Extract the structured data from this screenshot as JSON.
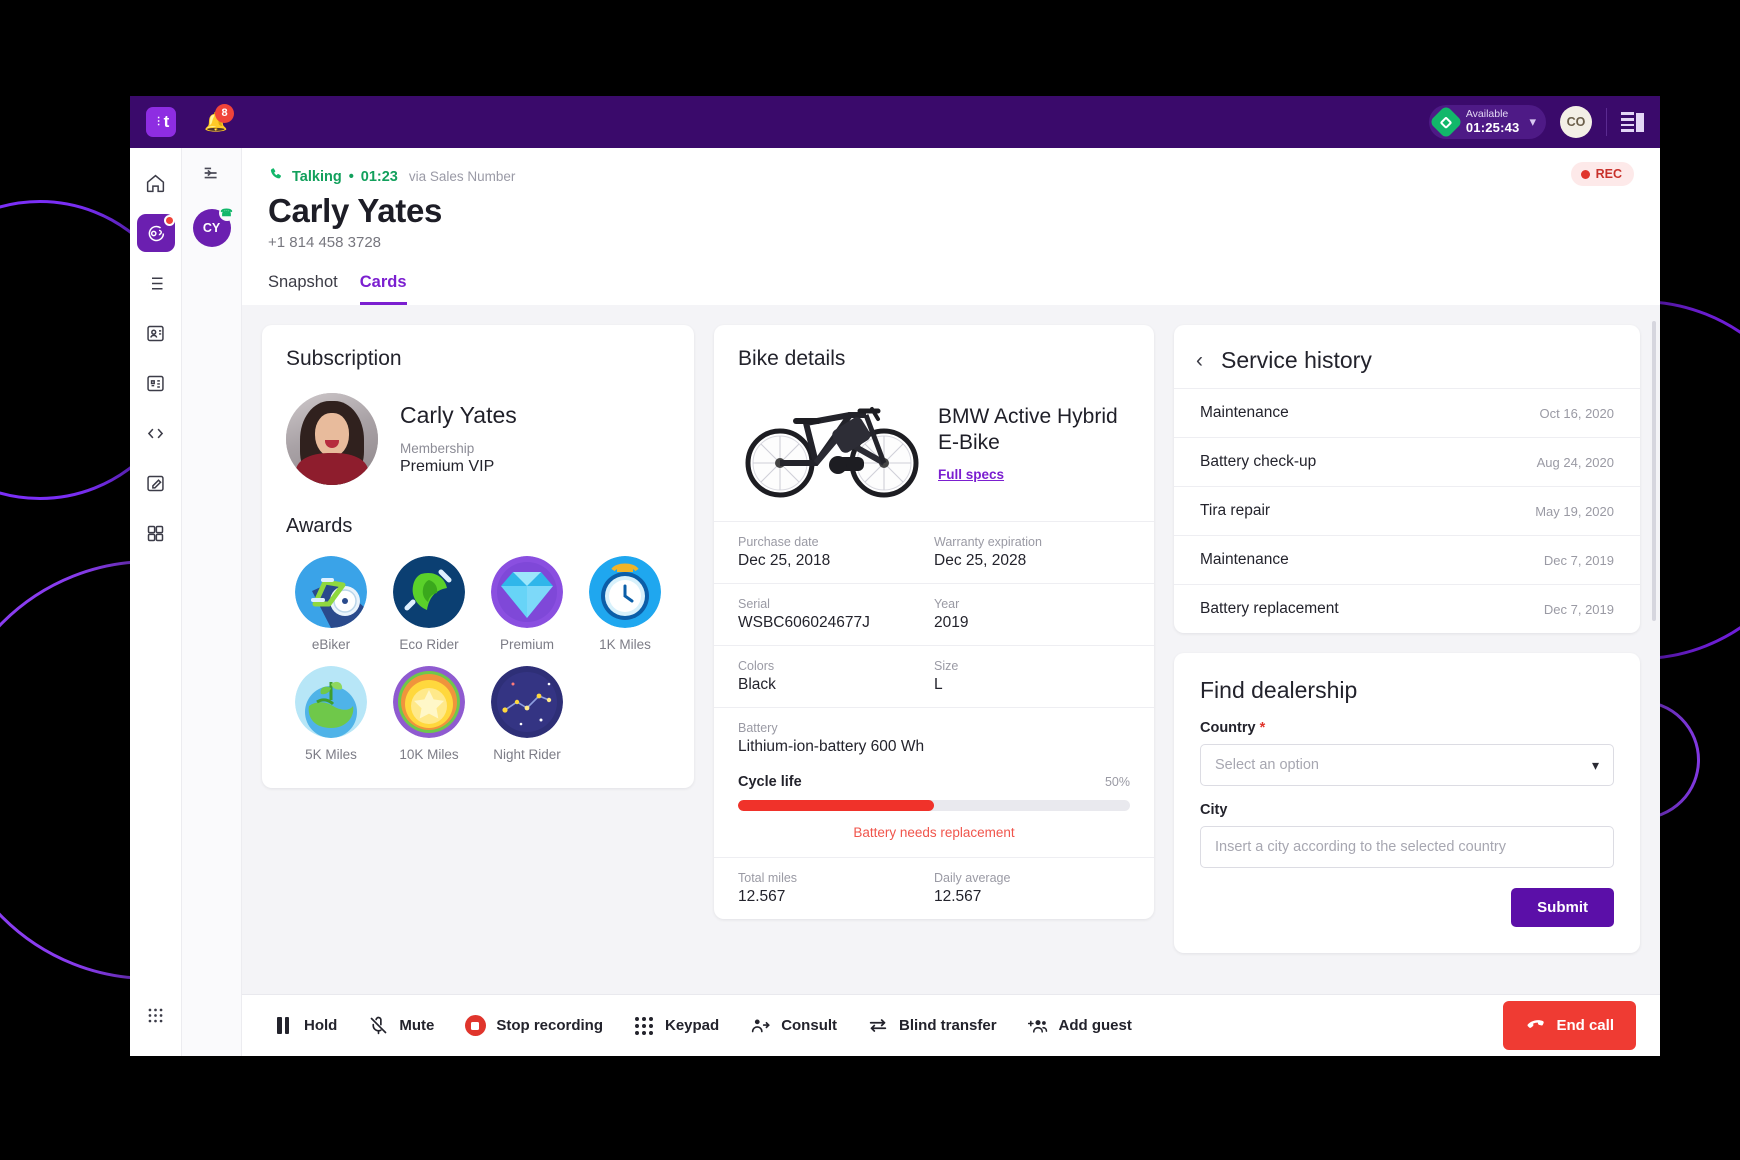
{
  "topbar": {
    "logo_text": "t",
    "notifications_count": "8",
    "status": {
      "label": "Available",
      "timer": "01:25:43"
    },
    "user_initials": "CO"
  },
  "rail": {
    "items": [
      {
        "name": "home",
        "glyph": "⌂"
      },
      {
        "name": "conversations",
        "glyph": "☉"
      },
      {
        "name": "queue",
        "glyph": "≡"
      },
      {
        "name": "contacts",
        "glyph": "□"
      },
      {
        "name": "reports",
        "glyph": "⊞"
      },
      {
        "name": "developer",
        "glyph": "</>"
      },
      {
        "name": "compose",
        "glyph": "✎"
      },
      {
        "name": "apps",
        "glyph": "⌸"
      }
    ],
    "bottom_glyph": "∷"
  },
  "rail2": {
    "collapse_glyph": "⇥",
    "contact_initials": "CY"
  },
  "call": {
    "state": "Talking",
    "separator": "•",
    "duration": "01:23",
    "via": "via Sales Number",
    "customer_name": "Carly Yates",
    "customer_phone": "+1 814 458 3728",
    "recording_badge": "REC"
  },
  "tabs": [
    {
      "label": "Snapshot",
      "active": false
    },
    {
      "label": "Cards",
      "active": true
    }
  ],
  "subscription": {
    "title": "Subscription",
    "member_name": "Carly Yates",
    "membership_label": "Membership",
    "membership_value": "Premium VIP",
    "awards_title": "Awards",
    "awards": [
      {
        "label": "eBiker",
        "icon": "ebike-badge-icon"
      },
      {
        "label": "Eco Rider",
        "icon": "eco-leaf-badge-icon"
      },
      {
        "label": "Premium",
        "icon": "diamond-badge-icon"
      },
      {
        "label": "1K Miles",
        "icon": "clock-badge-icon"
      },
      {
        "label": "5K Miles",
        "icon": "earth-plant-badge-icon"
      },
      {
        "label": "10K Miles",
        "icon": "gold-star-badge-icon"
      },
      {
        "label": "Night Rider",
        "icon": "constellation-badge-icon"
      }
    ]
  },
  "bike": {
    "title": "Bike details",
    "model": "BMW Active Hybrid E-Bike",
    "full_specs_link": "Full specs",
    "specs": [
      {
        "label": "Purchase date",
        "value": "Dec 25, 2018"
      },
      {
        "label": "Warranty expiration",
        "value": "Dec 25, 2028"
      },
      {
        "label": "Serial",
        "value": "WSBC606024677J"
      },
      {
        "label": "Year",
        "value": "2019"
      },
      {
        "label": "Colors",
        "value": "Black"
      },
      {
        "label": "Size",
        "value": "L"
      }
    ],
    "battery_label": "Battery",
    "battery_value": "Lithium-ion-battery 600 Wh",
    "cycle_life_label": "Cycle life",
    "cycle_life_percent": "50%",
    "cycle_life_fill": 50,
    "battery_warning": "Battery needs replacement",
    "totals": [
      {
        "label": "Total miles",
        "value": "12.567"
      },
      {
        "label": "Daily average",
        "value": "12.567"
      }
    ]
  },
  "service_history": {
    "title": "Service history",
    "back_glyph": "‹",
    "rows": [
      {
        "name": "Maintenance",
        "date": "Oct 16, 2020"
      },
      {
        "name": "Battery check-up",
        "date": "Aug 24, 2020"
      },
      {
        "name": "Tira repair",
        "date": "May 19, 2020"
      },
      {
        "name": "Maintenance",
        "date": "Dec 7, 2019"
      },
      {
        "name": "Battery replacement",
        "date": "Dec 7, 2019"
      }
    ]
  },
  "find_dealership": {
    "title": "Find dealership",
    "country_label": "Country",
    "country_required": "*",
    "country_placeholder": "Select an option",
    "city_label": "City",
    "city_placeholder": "Insert a city according to the selected country",
    "submit_label": "Submit"
  },
  "controls": [
    {
      "label": "Hold",
      "icon": "pause-icon"
    },
    {
      "label": "Mute",
      "icon": "microphone-muted-icon"
    },
    {
      "label": "Stop recording",
      "icon": "stop-recording-icon"
    },
    {
      "label": "Keypad",
      "icon": "keypad-icon"
    },
    {
      "label": "Consult",
      "icon": "consult-person-icon"
    },
    {
      "label": "Blind transfer",
      "icon": "transfer-arrows-icon"
    },
    {
      "label": "Add guest",
      "icon": "add-guest-icon"
    }
  ],
  "end_call": {
    "label": "End call",
    "icon": "phone-hangup-icon"
  },
  "colors": {
    "brand_purple": "#5b0fa8",
    "topbar_purple": "#3a0a6b",
    "accent_link": "#7b1fd0",
    "danger_red": "#ef3b33",
    "success_green": "#12b76a"
  }
}
